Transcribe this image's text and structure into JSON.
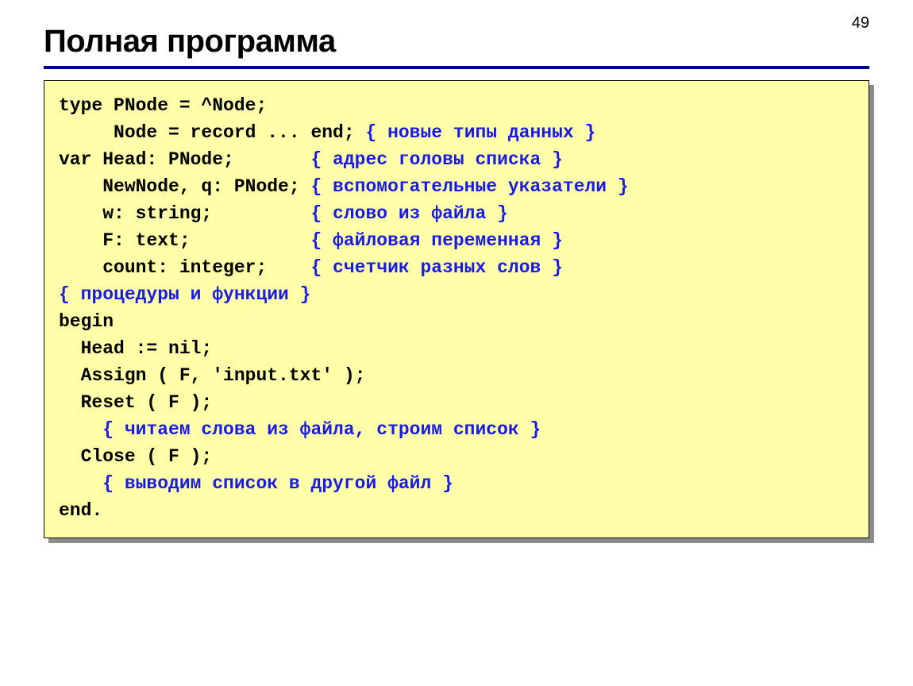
{
  "page_number": "49",
  "title": "Полная программа",
  "code": {
    "l1a": "type PNode = ^Node;",
    "l2a": "     Node = record ... end; ",
    "l2c": "{ новые типы данных }",
    "l3a": "var Head: PNode;       ",
    "l3c": "{ адрес головы списка }",
    "l4a": "    NewNode, q: PNode; ",
    "l4c": "{ вспомогательные указатели }",
    "l5a": "    w: string;         ",
    "l5c": "{ слово из файла }",
    "l6a": "    F: text;           ",
    "l6c": "{ файловая переменная }",
    "l7a": "    count: integer;    ",
    "l7c": "{ счетчик разных слов }",
    "l8c": "{ процедуры и функции }",
    "l9a": "begin",
    "l10a": "  Head := nil;",
    "l11a": "  Assign ( F, 'input.txt' );",
    "l12a": "  Reset ( F );",
    "l13c": "    { читаем слова из файла, строим список }",
    "l14a": "  Close ( F );",
    "l15c": "    { выводим список в другой файл }",
    "l16a": "end."
  }
}
